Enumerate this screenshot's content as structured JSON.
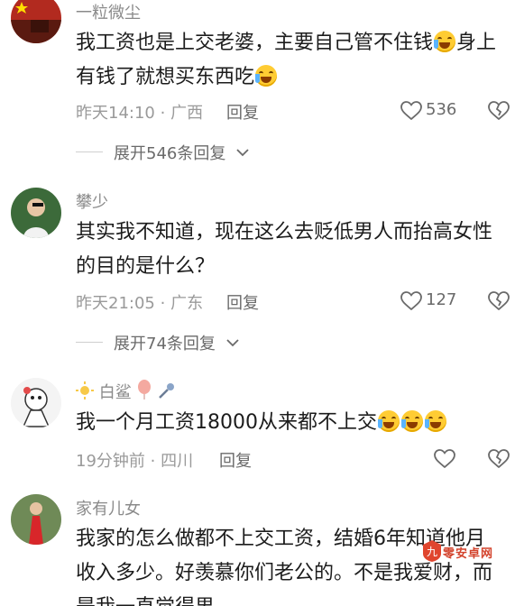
{
  "comments": [
    {
      "username": "一粒微尘",
      "text_part1": "我工资也是上交老婆，主要自己管不住钱",
      "text_part2": "身上有钱了就想买东西吃",
      "time": "昨天14:10",
      "location": "广西",
      "reply_label": "回复",
      "likes": "536",
      "expand_label": "展开546条回复"
    },
    {
      "username": "攀少",
      "text": "其实我不知道，现在这么去贬低男人而抬高女性的目的是什么？",
      "time": "昨天21:05",
      "location": "广东",
      "reply_label": "回复",
      "likes": "127",
      "expand_label": "展开74条回复"
    },
    {
      "username": "白鲨",
      "text": "我一个月工资18000从来都不上交",
      "time": "19分钟前",
      "location": "四川",
      "reply_label": "回复"
    },
    {
      "username": "家有儿女",
      "text": "我家的怎么做都不上交工资，结婚6年知道他月收入多少。好羡慕你们老公的。不是我爱财，而是我一直觉得男"
    }
  ],
  "separator": "·",
  "watermark": "零安卓网",
  "colors": {
    "meta_gray": "#9a9a9a",
    "emoji_yellow": "#ffcc33",
    "watermark_red": "#d3432c"
  },
  "icons": {
    "like": "heart-outline-icon",
    "dislike": "broken-heart-icon",
    "expand": "chevron-down-icon",
    "emoji": "laugh-cry-emoji"
  }
}
